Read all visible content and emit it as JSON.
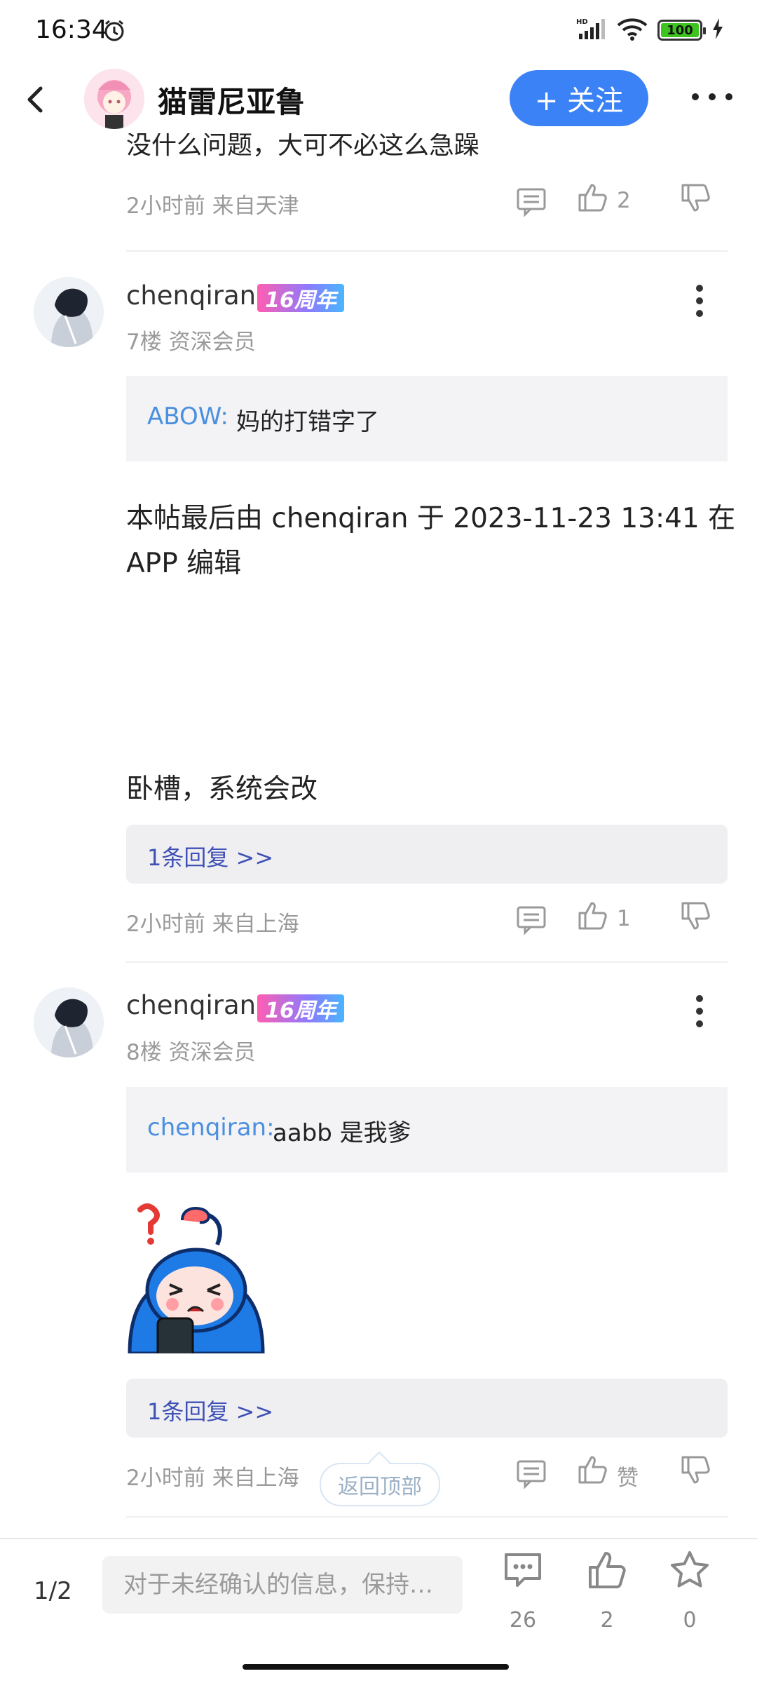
{
  "status_bar": {
    "time": "16:34",
    "battery": "100",
    "icons": [
      "alarm-icon",
      "hd-signal-icon",
      "wifi-icon",
      "battery-icon",
      "charging-icon"
    ]
  },
  "header": {
    "title": "猫雷尼亚鲁",
    "follow_label": "+ 关注",
    "icons": [
      "back-arrow-icon",
      "avatar",
      "more-dots-icon"
    ]
  },
  "post_prev": {
    "partial_text": "没什么问题，大可不必这么急躁",
    "meta": "2小时前 来自天津",
    "like_count": "2"
  },
  "post_7": {
    "username": "chenqiran",
    "badge": "16周年",
    "floor": "7楼 资深会员",
    "quote_name": "ABOW:",
    "quote_text": "妈的打错字了",
    "edit_note_line1": "本帖最后由 chenqiran 于 2023-11-23 13:41 在",
    "edit_note_line2": "APP 编辑",
    "text": "卧槽，系统会改",
    "reply_link": "1条回复 >>",
    "meta": "2小时前 来自上海",
    "like_count": "1"
  },
  "post_8": {
    "username": "chenqiran",
    "badge": "16周年",
    "floor": "8楼 资深会员",
    "quote_name": "chenqiran:",
    "quote_text": "aabb 是我爹",
    "reply_link": "1条回复 >>",
    "meta": "2小时前 来自上海",
    "like_label": "赞"
  },
  "back_to_top": "返回顶部",
  "bottom_bar": {
    "page": "1/2",
    "placeholder": "对于未经确认的信息，保持…",
    "comments": "26",
    "likes": "2",
    "favorites": "0"
  },
  "colors": {
    "accent": "#3b82f6",
    "quote_name": "#4a8fe0",
    "reply_link": "#3f51b5",
    "meta": "#9a9a9a"
  }
}
